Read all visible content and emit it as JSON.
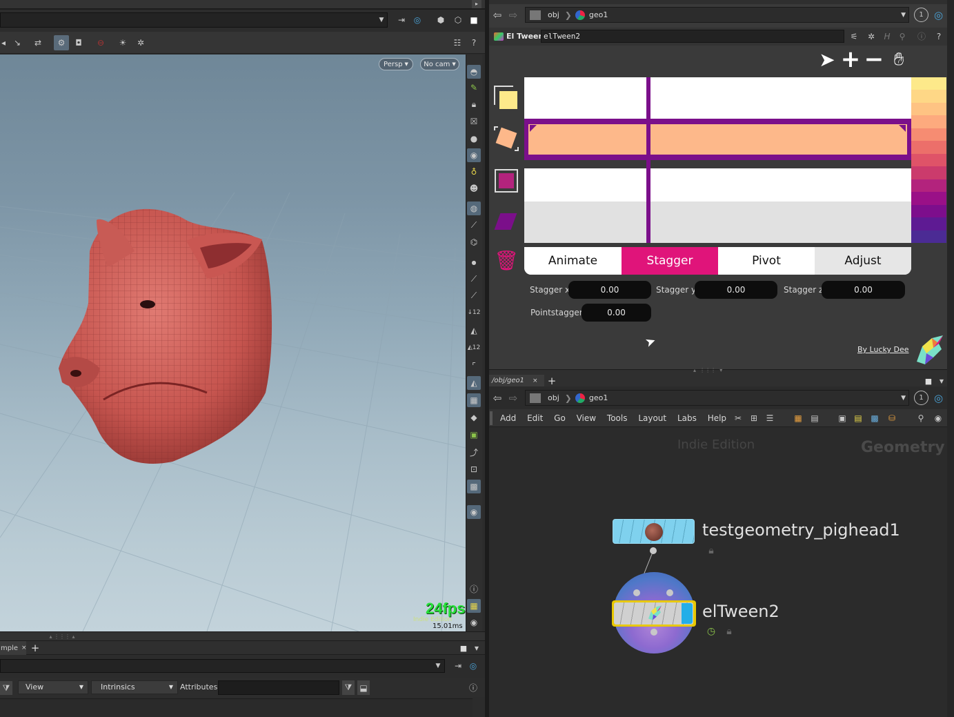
{
  "viewport": {
    "persp_label": "Persp",
    "cam_label": "No cam",
    "fps": "24fps",
    "watermark": "Indie Edition",
    "ms": "15.01ms"
  },
  "bottom_left": {
    "tab_label": "mple",
    "view_label": "View",
    "intrinsics_label": "Intrinsics",
    "attributes_label": "Attributes:"
  },
  "param_pane": {
    "path_obj": "obj",
    "path_geo": "geo1",
    "node_type": "El Tween",
    "node_name": "elTween2",
    "tabs": [
      "Animate",
      "Stagger",
      "Pivot",
      "Adjust"
    ],
    "active_tab": "Stagger",
    "stagger_x_label": "Stagger x",
    "stagger_x_value": "0.00",
    "stagger_y_label": "Stagger y",
    "stagger_y_value": "0.00",
    "stagger_z_label": "Stagger z",
    "stagger_z_value": "0.00",
    "pointstagger_label": "Pointstagger",
    "pointstagger_value": "0.00",
    "credit": "By Lucky Dee",
    "palette": [
      "#fde98a",
      "#fed786",
      "#fec383",
      "#fdaa7e",
      "#f68c72",
      "#ec6f6a",
      "#df5368",
      "#cb3b6c",
      "#b3237d",
      "#9a1087",
      "#7d0e8c",
      "#5e1a93",
      "#4b2b94"
    ]
  },
  "network_pane": {
    "tab_label": "/obj/geo1",
    "path_obj": "obj",
    "path_geo": "geo1",
    "menu": [
      "Add",
      "Edit",
      "Go",
      "View",
      "Tools",
      "Layout",
      "Labs",
      "Help"
    ],
    "watermark": "Indie Edition",
    "context": "Geometry",
    "node1_label": "testgeometry_pighead1",
    "node2_label": "elTween2"
  },
  "colors": {
    "accent_pink": "#e0147a",
    "tween_purple": "#7b0f8a",
    "swatch_yellow": "#fde98a",
    "swatch_peach": "#fdb88a"
  }
}
